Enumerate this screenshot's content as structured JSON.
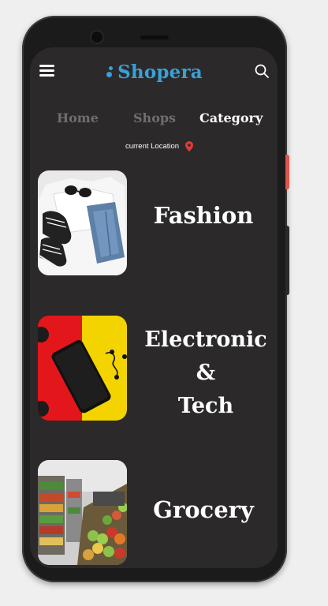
{
  "header": {
    "app_name": "Shopera",
    "menu_icon": "hamburger-menu-icon",
    "search_icon": "search-icon",
    "brand_color": "#3aa0d8"
  },
  "tabs": [
    {
      "label": "Home",
      "active": false
    },
    {
      "label": "Shops",
      "active": false
    },
    {
      "label": "Category",
      "active": true
    }
  ],
  "location": {
    "label": "current Location",
    "icon": "location-pin-icon",
    "icon_color": "#e53935"
  },
  "categories": [
    {
      "label": "Fashion",
      "image": "fashion-image"
    },
    {
      "label": "Electronic\n&\nTech",
      "image": "electronics-image"
    },
    {
      "label": "Grocery",
      "image": "grocery-image"
    }
  ],
  "colors": {
    "screen_background": "#2b2929",
    "inactive_tab": "#6f6f6f",
    "active_tab": "#ffffff"
  }
}
